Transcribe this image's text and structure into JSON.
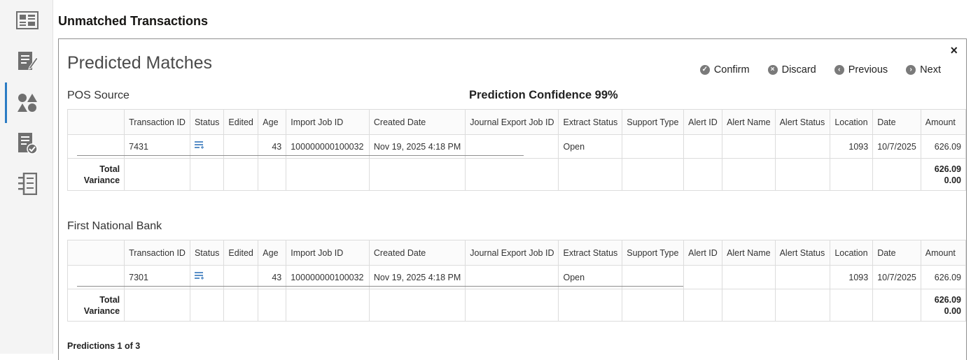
{
  "page_title": "Unmatched Transactions",
  "rail": {
    "items": [
      {
        "icon": "dashboard-icon"
      },
      {
        "icon": "edit-list-icon"
      },
      {
        "icon": "shapes-icon"
      },
      {
        "icon": "checklist-icon"
      },
      {
        "icon": "report-icon"
      }
    ]
  },
  "dialog": {
    "title": "Predicted Matches",
    "close_label": "×",
    "actions": {
      "confirm": "Confirm",
      "discard": "Discard",
      "previous": "Previous",
      "next": "Next"
    },
    "confidence": "Prediction Confidence 99%",
    "footer": "Predictions 1 of 3",
    "columns": [
      "Transaction ID",
      "Status",
      "Edited",
      "Age",
      "Import Job ID",
      "Created Date",
      "Journal Export Job ID",
      "Extract Status",
      "Support Type",
      "Alert ID",
      "Alert Name",
      "Alert Status",
      "Location",
      "Date",
      "Amount"
    ],
    "sections": [
      {
        "label": "POS Source",
        "row": {
          "transaction_id": "7431",
          "edited": "",
          "age": "43",
          "import_job_id": "100000000100032",
          "created_date": "Nov 19, 2025 4:18 PM",
          "journal_export_job_id": "",
          "extract_status": "Open",
          "support_type": "",
          "alert_id": "",
          "alert_name": "",
          "alert_status": "",
          "location": "1093",
          "date": "10/7/2025",
          "amount": "626.09"
        },
        "total_label": "Total",
        "variance_label": "Variance",
        "total_amount": "626.09",
        "variance_amount": "0.00"
      },
      {
        "label": "First National Bank",
        "row": {
          "transaction_id": "7301",
          "edited": "",
          "age": "43",
          "import_job_id": "100000000100032",
          "created_date": "Nov 19, 2025 4:18 PM",
          "journal_export_job_id": "",
          "extract_status": "Open",
          "support_type": "",
          "alert_id": "",
          "alert_name": "",
          "alert_status": "",
          "location": "1093",
          "date": "10/7/2025",
          "amount": "626.09"
        },
        "total_label": "Total",
        "variance_label": "Variance",
        "total_amount": "626.09",
        "variance_amount": "0.00"
      }
    ]
  },
  "colors": {
    "accent": "#2b7cc4",
    "icon_gray": "#6f6f6f",
    "status_icon": "#5a8fc7"
  }
}
